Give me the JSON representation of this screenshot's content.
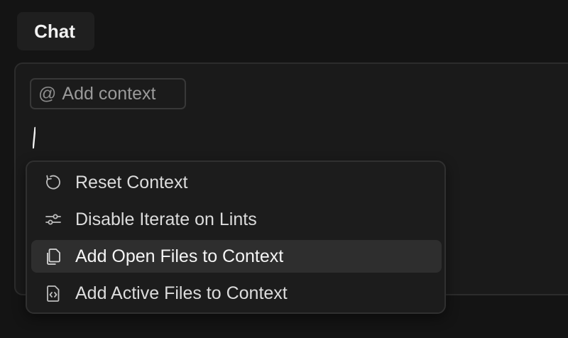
{
  "header": {
    "tab_label": "Chat"
  },
  "composer": {
    "add_context_label": "Add context",
    "at_symbol": "@",
    "input_value": "/"
  },
  "slash_menu": {
    "items": [
      {
        "label": "Reset Context",
        "icon": "reset-icon"
      },
      {
        "label": "Disable Iterate on Lints",
        "icon": "sliders-icon"
      },
      {
        "label": "Add Open Files to Context",
        "icon": "files-icon",
        "highlighted": true
      },
      {
        "label": "Add Active Files to Context",
        "icon": "code-file-icon"
      }
    ]
  }
}
